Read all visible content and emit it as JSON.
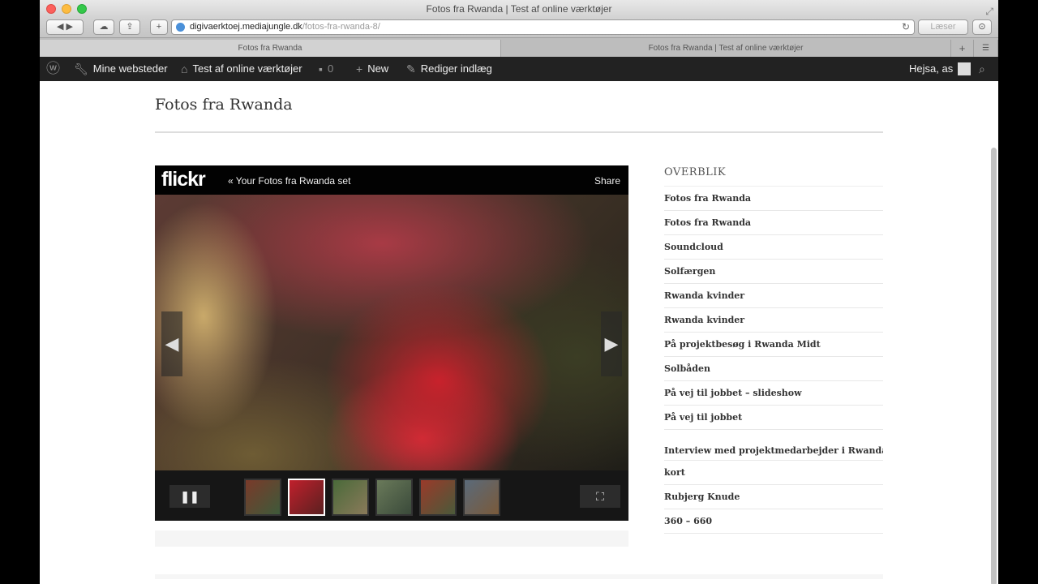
{
  "browser": {
    "window_title": "Fotos fra Rwanda | Test af online værktøjer",
    "url_host": "digivaerktoej.mediajungle.dk",
    "url_path": "/fotos-fra-rwanda-8/",
    "reader_label": "Læser",
    "tabs": [
      {
        "label": "Fotos fra Rwanda"
      },
      {
        "label": "Fotos fra Rwanda | Test af online værktøjer"
      }
    ]
  },
  "adminbar": {
    "my_sites": "Mine websteder",
    "site_name": "Test af online værktøjer",
    "comments_count": "0",
    "new_label": "New",
    "edit_label": "Rediger indlæg",
    "greeting": "Hejsa, as"
  },
  "page": {
    "title": "Fotos fra Rwanda"
  },
  "flickr": {
    "logo": "flickr",
    "set_label": "« Your Fotos fra Rwanda set",
    "share_label": "Share",
    "pause_symbol": "❚❚",
    "expand_symbol": "⛶",
    "prev_symbol": "◀",
    "next_symbol": "▶"
  },
  "sidebar": {
    "widget_title": "OVERBLIK",
    "items": [
      "Fotos fra Rwanda",
      "Fotos fra Rwanda",
      "Soundcloud",
      "Solfærgen",
      "Rwanda kvinder",
      "Rwanda kvinder",
      "På projektbesøg i Rwanda Midt",
      "Solbåden",
      "På vej til jobbet – slideshow",
      "På vej til jobbet",
      "Interview med projektmedarbejder i Rwanda",
      "kort",
      "Rubjerg Knude",
      "360 – 660"
    ]
  }
}
